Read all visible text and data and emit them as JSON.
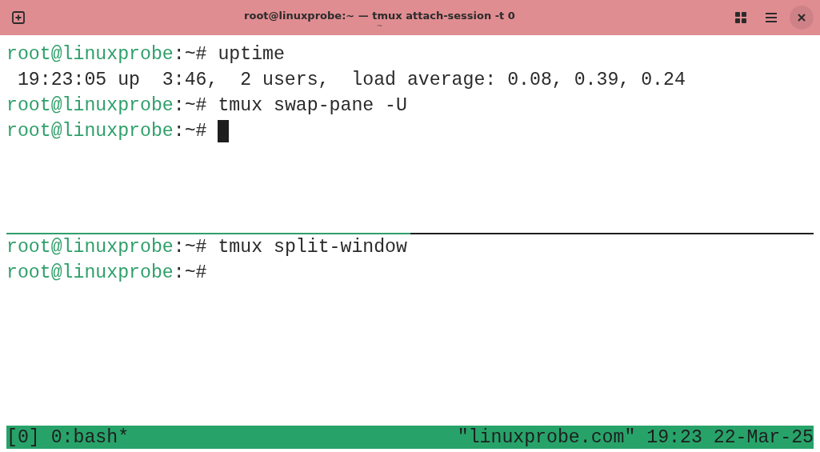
{
  "window": {
    "title": "root@linuxprobe:~ — tmux attach-session -t 0",
    "subtitle": "~"
  },
  "panes": [
    {
      "active": true,
      "lines": [
        {
          "kind": "prompt",
          "host": "root@linuxprobe",
          "path": ":~#",
          "command": "uptime",
          "cursor": false
        },
        {
          "kind": "output",
          "text": " 19:23:05 up  3:46,  2 users,  load average: 0.08, 0.39, 0.24"
        },
        {
          "kind": "prompt",
          "host": "root@linuxprobe",
          "path": ":~#",
          "command": "tmux swap-pane -U",
          "cursor": false
        },
        {
          "kind": "prompt",
          "host": "root@linuxprobe",
          "path": ":~#",
          "cursor": true
        }
      ]
    },
    {
      "active": false,
      "lines": [
        {
          "kind": "prompt",
          "host": "root@linuxprobe",
          "path": ":~#",
          "command": "tmux split-window",
          "cursor": false
        },
        {
          "kind": "prompt",
          "host": "root@linuxprobe",
          "path": ":~#",
          "cursor": false
        }
      ]
    }
  ],
  "status_bar": {
    "left": "[0] 0:bash*",
    "right": "\"linuxprobe.com\" 19:23 22-Mar-25"
  }
}
